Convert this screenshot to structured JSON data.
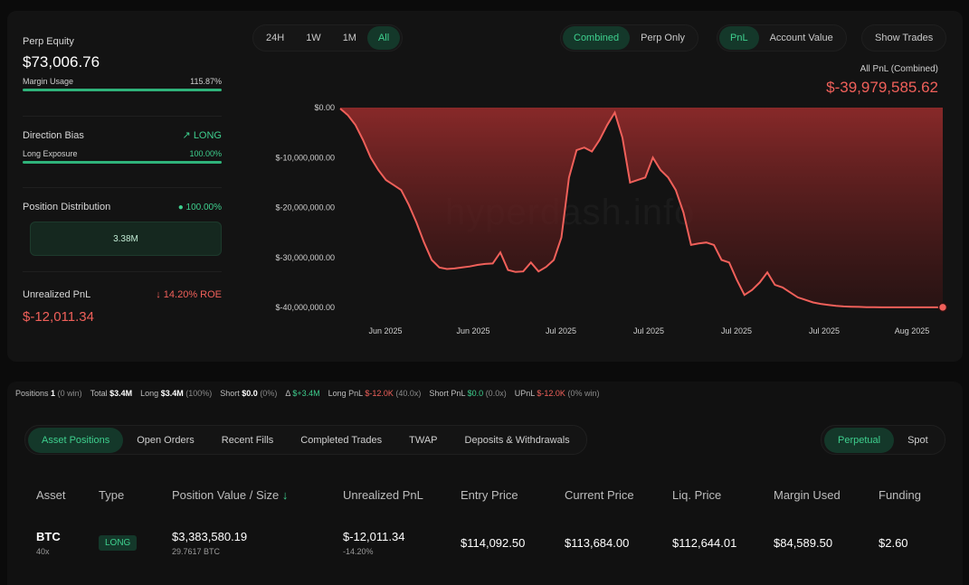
{
  "left": {
    "perp_equity_label": "Perp Equity",
    "perp_equity_value": "$73,006.76",
    "margin_usage_label": "Margin Usage",
    "margin_usage_value": "115.87%",
    "margin_usage_fill": 1.0,
    "direction_bias_label": "Direction Bias",
    "direction_bias_value": "LONG",
    "long_exposure_label": "Long Exposure",
    "long_exposure_value": "100.00%",
    "long_exposure_fill": 1.0,
    "position_distribution_label": "Position Distribution",
    "position_distribution_value": "100.00%",
    "distribution_block_value": "3.38M",
    "unrealized_pnl_label": "Unrealized PnL",
    "unrealized_roe": "14.20% ROE",
    "unrealized_pnl_value": "$-12,011.34"
  },
  "range_tabs": [
    "24H",
    "1W",
    "1M",
    "All"
  ],
  "range_active": "All",
  "mode_tabs": [
    "Combined",
    "Perp Only"
  ],
  "metric_tabs": [
    "PnL",
    "Account Value"
  ],
  "show_trades_label": "Show Trades",
  "pnl_summary": {
    "title": "All PnL (Combined)",
    "value": "$-39,979,585.62"
  },
  "watermark": "hyperdash.info",
  "chart_data": {
    "type": "area",
    "ylim": [
      -40000000,
      0
    ],
    "yticks": [
      0,
      -10000000,
      -20000000,
      -30000000,
      -40000000
    ],
    "ytick_labels": [
      "$0.00",
      "$-10,000,000.00",
      "$-20,000,000.00",
      "$-30,000,000.00",
      "$-40,000,000.00"
    ],
    "xtick_labels": [
      "Jun 2025",
      "Jun 2025",
      "Jul 2025",
      "Jul 2025",
      "Jul 2025",
      "Jul 2025",
      "Aug 2025"
    ],
    "series": [
      {
        "color": "#f0605a",
        "x": [
          0,
          1,
          2,
          3,
          4,
          5,
          6,
          7,
          8,
          9,
          10,
          11,
          12,
          13,
          14,
          15,
          16,
          17,
          18,
          19,
          20,
          21,
          22,
          23,
          24,
          25,
          26,
          27,
          28,
          29,
          30,
          31,
          32,
          33,
          34,
          35,
          36,
          37,
          38,
          39,
          40,
          41,
          42,
          43,
          44,
          45,
          46,
          47,
          48,
          49,
          50,
          51,
          52,
          53,
          54,
          55,
          56,
          57,
          58,
          59,
          60,
          61,
          62,
          63,
          64,
          65,
          66,
          67,
          68,
          69,
          70,
          71,
          72,
          73,
          74,
          75,
          76,
          77,
          78,
          79
        ],
        "y": [
          -200000,
          -1500000,
          -3500000,
          -6500000,
          -10000000,
          -12500000,
          -14500000,
          -15500000,
          -16500000,
          -19500000,
          -23000000,
          -27000000,
          -30500000,
          -32000000,
          -32300000,
          -32200000,
          -32000000,
          -31800000,
          -31500000,
          -31300000,
          -31200000,
          -29000000,
          -32500000,
          -32900000,
          -32800000,
          -31000000,
          -32800000,
          -31900000,
          -30500000,
          -26000000,
          -14000000,
          -8500000,
          -8000000,
          -8800000,
          -6500000,
          -3500000,
          -1000000,
          -6000000,
          -15000000,
          -14500000,
          -14000000,
          -10000000,
          -12500000,
          -14000000,
          -16500000,
          -21000000,
          -27500000,
          -27200000,
          -27000000,
          -27500000,
          -30500000,
          -31000000,
          -34500000,
          -37500000,
          -36500000,
          -35000000,
          -33000000,
          -35500000,
          -36000000,
          -37000000,
          -38000000,
          -38500000,
          -39000000,
          -39300000,
          -39500000,
          -39700000,
          -39800000,
          -39850000,
          -39900000,
          -39950000,
          -39970000,
          -39975000,
          -39978000,
          -39979000,
          -39979300,
          -39979400,
          -39979500,
          -39979550,
          -39979580,
          -39979585.62
        ]
      }
    ]
  },
  "summary": {
    "positions_label": "Positions",
    "positions_count": "1",
    "positions_win": "(0 win)",
    "total_label": "Total",
    "total_value": "$3.4M",
    "long_label": "Long",
    "long_value": "$3.4M",
    "long_pct": "(100%)",
    "short_label": "Short",
    "short_value": "$0.0",
    "short_pct": "(0%)",
    "delta_label": "Δ",
    "delta_value": "$+3.4M",
    "long_pnl_label": "Long PnL",
    "long_pnl_value": "$-12.0K",
    "long_pnl_x": "(40.0x)",
    "short_pnl_label": "Short PnL",
    "short_pnl_value": "$0.0",
    "short_pnl_x": "(0.0x)",
    "upnl_label": "UPnL",
    "upnl_value": "$-12.0K",
    "upnl_win": "(0% win)"
  },
  "tabs": [
    "Asset Positions",
    "Open Orders",
    "Recent Fills",
    "Completed Trades",
    "TWAP",
    "Deposits & Withdrawals"
  ],
  "tab_active": "Asset Positions",
  "market_tabs": [
    "Perpetual",
    "Spot"
  ],
  "market_active": "Perpetual",
  "table": {
    "headers": [
      "Asset",
      "Type",
      "Position Value / Size",
      "Unrealized PnL",
      "Entry Price",
      "Current Price",
      "Liq. Price",
      "Margin Used",
      "Funding"
    ],
    "sort_arrow": "↓",
    "row": {
      "asset": "BTC",
      "leverage": "40x",
      "type": "LONG",
      "position_value": "$3,383,580.19",
      "position_size": "29.7617 BTC",
      "unrealized_pnl": "$-12,011.34",
      "unrealized_pct": "-14.20%",
      "entry_price": "$114,092.50",
      "current_price": "$113,684.00",
      "liq_price": "$112,644.01",
      "margin_used": "$84,589.50",
      "funding": "$2.60"
    }
  },
  "colors": {
    "accent_green": "#3ecf8e",
    "negative_red": "#f0605a",
    "background": "#0b0b0b"
  }
}
